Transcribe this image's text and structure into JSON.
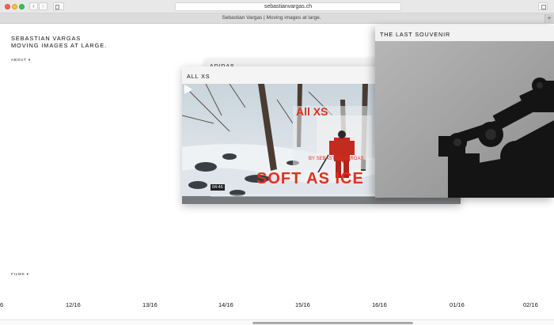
{
  "browser": {
    "url": "sebastianvargas.ch",
    "tab_title": "Sebastian Vargas | Moving images at large.",
    "new_tab": "+",
    "back": "‹",
    "forward": "›"
  },
  "site": {
    "title": "SEBASTIAN VARGAS",
    "subtitle": "MOVING IMAGES AT LARGE.",
    "about": "ABOUT ▾",
    "films": "FILMS ▾"
  },
  "cards": {
    "adidas": "ADIDAS",
    "allxs": {
      "title": "ALL XS",
      "overlay_title": "All XS",
      "overlay_credit": "BY SEBASTIAN VARGAS",
      "overlay_band": "SOFT AS ICE",
      "duration": "04:46"
    },
    "souvenir": {
      "title": "THE LAST SOUVENIR"
    }
  },
  "timeline": [
    "6",
    "12/16",
    "13/16",
    "14/16",
    "15/16",
    "16/16",
    "01/16",
    "02/16"
  ],
  "colors": {
    "accent_red": "#e0301e",
    "background": "#ffffff"
  }
}
